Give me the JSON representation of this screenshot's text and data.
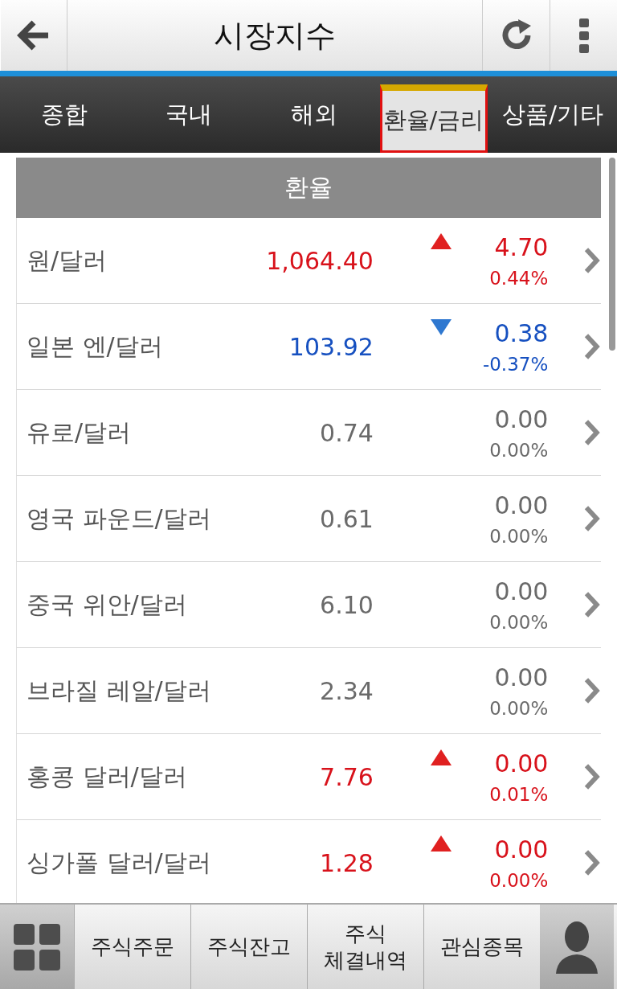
{
  "header": {
    "title": "시장지수"
  },
  "tabs": [
    {
      "label": "종합",
      "selected": false
    },
    {
      "label": "국내",
      "selected": false
    },
    {
      "label": "해외",
      "selected": false
    },
    {
      "label": "환율/금리",
      "selected": true
    },
    {
      "label": "상품/기타",
      "selected": false
    }
  ],
  "section": {
    "title": "환율"
  },
  "rows": [
    {
      "name": "원/달러",
      "value": "1,064.40",
      "kind": "up",
      "change": "4.70",
      "percent": "0.44%"
    },
    {
      "name": "일본 엔/달러",
      "value": "103.92",
      "kind": "down",
      "change": "0.38",
      "percent": "-0.37%"
    },
    {
      "name": "유로/달러",
      "value": "0.74",
      "kind": "flat",
      "change": "0.00",
      "percent": "0.00%"
    },
    {
      "name": "영국 파운드/달러",
      "value": "0.61",
      "kind": "flat",
      "change": "0.00",
      "percent": "0.00%"
    },
    {
      "name": "중국 위안/달러",
      "value": "6.10",
      "kind": "flat",
      "change": "0.00",
      "percent": "0.00%"
    },
    {
      "name": "브라질 레알/달러",
      "value": "2.34",
      "kind": "flat",
      "change": "0.00",
      "percent": "0.00%"
    },
    {
      "name": "홍콩 달러/달러",
      "value": "7.76",
      "kind": "up",
      "change": "0.00",
      "percent": "0.01%"
    },
    {
      "name": "싱가폴 달러/달러",
      "value": "1.28",
      "kind": "up",
      "change": "0.00",
      "percent": "0.00%"
    }
  ],
  "bottom_bar": {
    "items": [
      {
        "label": "주식주문"
      },
      {
        "label": "주식잔고"
      },
      {
        "label": "주식 체결내역"
      },
      {
        "label": "관심종목"
      }
    ]
  }
}
